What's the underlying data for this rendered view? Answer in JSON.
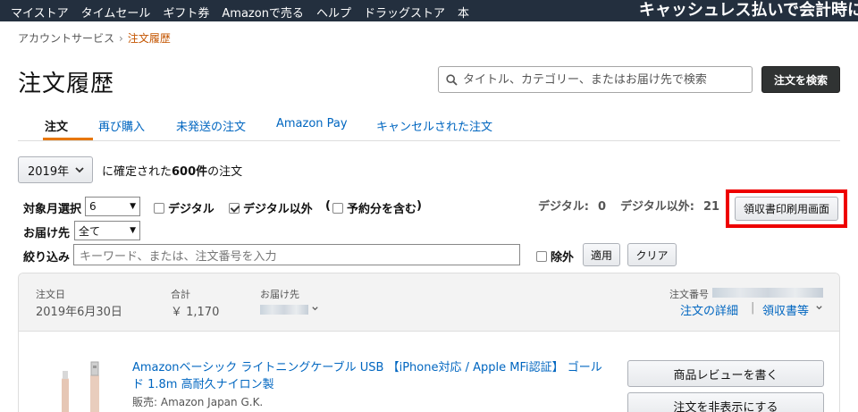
{
  "topnav": {
    "links": [
      "マイストア",
      "タイムセール",
      "ギフト券",
      "Amazonで売る",
      "ヘルプ",
      "ドラッグストア",
      "本"
    ],
    "banner": "キャッシュレス払いで会計時に"
  },
  "breadcrumb": {
    "parent": "アカウントサービス",
    "separator": "›",
    "current": "注文履歴"
  },
  "page_title": "注文履歴",
  "search": {
    "placeholder": "タイトル、カテゴリー、またはお届け先で検索",
    "button": "注文を検索"
  },
  "tabs": [
    "注文",
    "再び購入",
    "未発送の注文",
    "Amazon Pay",
    "キャンセルされた注文"
  ],
  "year_filter": {
    "selected": "2019年",
    "text_prefix": "に確定された",
    "count": "600件",
    "text_suffix": "の注文"
  },
  "filters": {
    "month_label": "対象月選択",
    "month_value": "6",
    "digital_label": "デジタル",
    "non_digital_label": "デジタル以外",
    "preorder_label": "予約分を含む",
    "paren_open": "(",
    "paren_close": ")",
    "deliver_label": "お届け先",
    "deliver_value": "全て",
    "narrow_label": "絞り込み",
    "keyword_placeholder": "キーワード、または、注文番号を入力",
    "exclude_label": "除外",
    "apply": "適用",
    "clear": "クリア"
  },
  "counts": {
    "digital_label": "デジタル:",
    "digital_value": "0",
    "non_digital_label": "デジタル以外:",
    "non_digital_value": "21"
  },
  "receipt_button": "領収書印刷用画面",
  "order": {
    "date_label": "注文日",
    "date_value": "2019年6月30日",
    "total_label": "合計",
    "total_value": "￥ 1,170",
    "ship_label": "お届け先",
    "order_no_label": "注文番号",
    "details_link": "注文の詳細",
    "link_sep": "|",
    "receipt_link": "領収書等",
    "product_title": "Amazonベーシック ライトニングケーブル USB 【iPhone対応 / Apple MFi認証】 ゴールド 1.8m 高耐久ナイロン製",
    "seller": "販売: Amazon Japan G.K.",
    "review_button": "商品レビューを書く",
    "hide_button": "注文を非表示にする"
  },
  "colors": {
    "nav_bg": "#232f3e",
    "link": "#0066c0",
    "accent": "#e77600",
    "highlight_border": "#e00000"
  }
}
